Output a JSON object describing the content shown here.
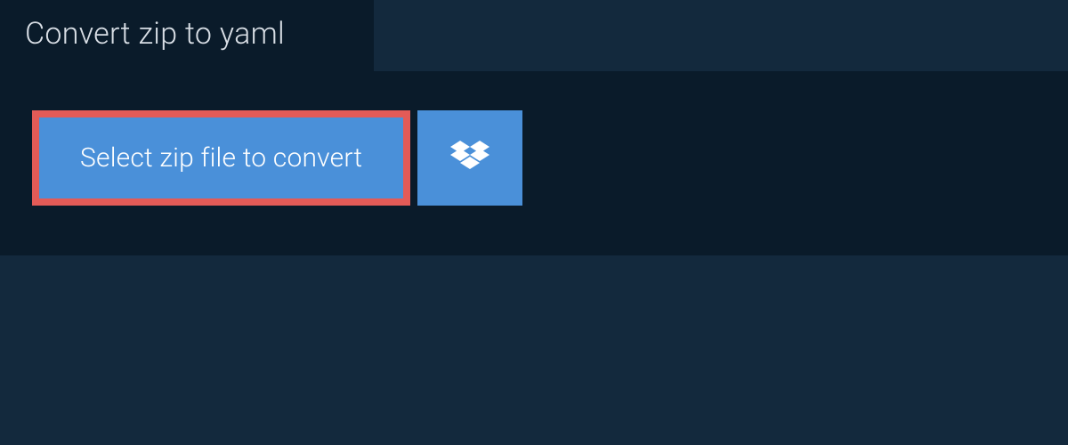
{
  "tab": {
    "title": "Convert zip to yaml"
  },
  "actions": {
    "select_file_label": "Select zip file to convert"
  },
  "colors": {
    "page_bg": "#13293d",
    "panel_bg": "#0a1b2a",
    "button_bg": "#4a90d9",
    "highlight_border": "#e35b57",
    "text_light": "#d8dee5",
    "text_white": "#ffffff"
  }
}
